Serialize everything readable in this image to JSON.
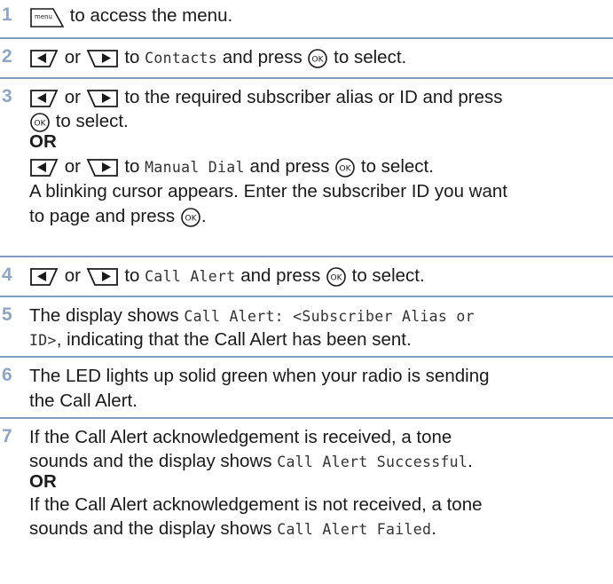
{
  "steps": [
    {
      "number": "1",
      "lines": [
        {
          "seg1": "to access the menu."
        }
      ]
    },
    {
      "number": "2",
      "lines": [
        {
          "or": "or",
          "to": "to",
          "mono": "Contacts",
          "and_press": "and press",
          "tail": "to select."
        }
      ]
    },
    {
      "number": "3",
      "lines": [
        {
          "or": "or",
          "text": "to the required subscriber alias or ID and press"
        },
        {
          "text": "to select."
        },
        {
          "text": "OR"
        },
        {
          "or": "or",
          "to": "to",
          "mono": "Manual Dial",
          "and_press": "and press",
          "tail": "to select."
        },
        {
          "text": "A blinking cursor appears. Enter the subscriber ID you want"
        },
        {
          "text": "to page and press",
          "tail": "."
        }
      ]
    },
    {
      "number": "4",
      "lines": [
        {
          "or": "or",
          "to": "to",
          "mono": "Call Alert",
          "and_press": "and press",
          "tail": "to select."
        }
      ]
    },
    {
      "number": "5",
      "lines": [
        {
          "pre": "The display shows",
          "mono": "Call Alert: <Subscriber Alias or"
        },
        {
          "mono": "ID>",
          "post": ", indicating that the Call Alert has been sent."
        }
      ]
    },
    {
      "number": "6",
      "lines": [
        {
          "text": "The LED lights up solid green when your radio is sending"
        },
        {
          "text": "the Call Alert."
        }
      ]
    },
    {
      "number": "7",
      "lines": [
        {
          "text": "If the Call Alert acknowledgement is received, a tone"
        },
        {
          "pre": "sounds and the display shows",
          "mono": "Call Alert Successful",
          "post": "."
        },
        {
          "text": "OR"
        },
        {
          "text": "If the Call Alert acknowledgement is not received, a tone"
        },
        {
          "pre": "sounds and the display shows",
          "mono": "Call Alert Failed",
          "post": "."
        }
      ]
    }
  ],
  "icons": {
    "menu_label": "menu",
    "ok_label": "OK"
  },
  "colors": {
    "step_number": "#8fa6c0",
    "separator": "#7f9cbd",
    "text": "#1a1a1a"
  }
}
